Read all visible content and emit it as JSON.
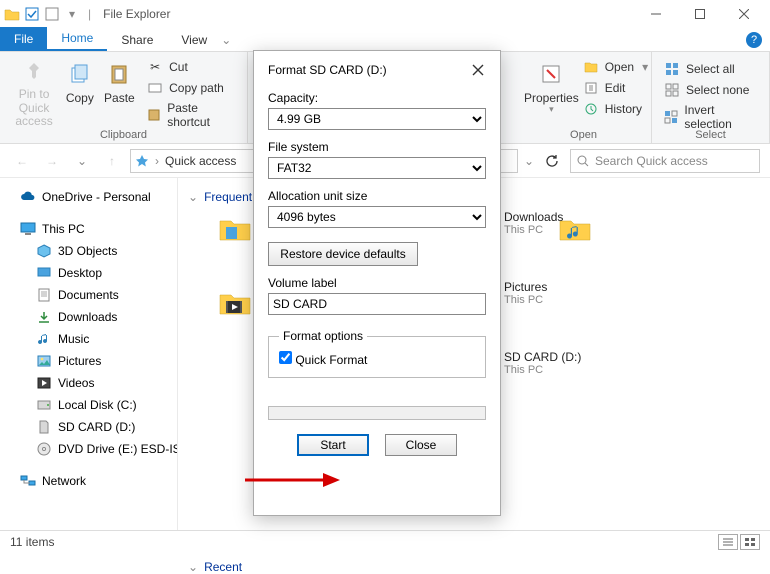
{
  "window": {
    "title": "File Explorer"
  },
  "tabs": {
    "file": "File",
    "home": "Home",
    "share": "Share",
    "view": "View"
  },
  "ribbon": {
    "clipboard": {
      "label": "Clipboard",
      "pin": "Pin to Quick access",
      "copy": "Copy",
      "paste": "Paste",
      "cut": "Cut",
      "copypath": "Copy path",
      "shortcut": "Paste shortcut"
    },
    "properties": {
      "btn": "Properties",
      "open": "Open",
      "edit": "Edit",
      "history": "History",
      "group": "Open"
    },
    "select": {
      "all": "Select all",
      "none": "Select none",
      "invert": "Invert selection",
      "group": "Select"
    }
  },
  "address": {
    "crumb": "Quick access",
    "search_placeholder": "Search Quick access"
  },
  "nav": {
    "onedrive": "OneDrive - Personal",
    "thispc": "This PC",
    "objects3d": "3D Objects",
    "desktop": "Desktop",
    "documents": "Documents",
    "downloads": "Downloads",
    "music": "Music",
    "pictures": "Pictures",
    "videos": "Videos",
    "localdisk": "Local Disk (C:)",
    "sdcard": "SD CARD (D:)",
    "dvd": "DVD Drive (E:) ESD-IS",
    "network": "Network"
  },
  "content": {
    "section1": "Frequent",
    "section2_prefix": "Recent",
    "downloads": {
      "name": "Downloads",
      "sub": "This PC"
    },
    "pictures": {
      "name": "Pictures",
      "sub": "This PC"
    },
    "sdcard": {
      "name": "SD CARD (D:)",
      "sub": "This PC"
    }
  },
  "status": {
    "items": "11 items"
  },
  "dialog": {
    "title": "Format SD CARD (D:)",
    "capacity_label": "Capacity:",
    "capacity_value": "4.99 GB",
    "fs_label": "File system",
    "fs_value": "FAT32",
    "au_label": "Allocation unit size",
    "au_value": "4096 bytes",
    "restore": "Restore device defaults",
    "vol_label": "Volume label",
    "vol_value": "SD CARD",
    "opts_label": "Format options",
    "quick": "Quick Format",
    "start": "Start",
    "close": "Close"
  }
}
